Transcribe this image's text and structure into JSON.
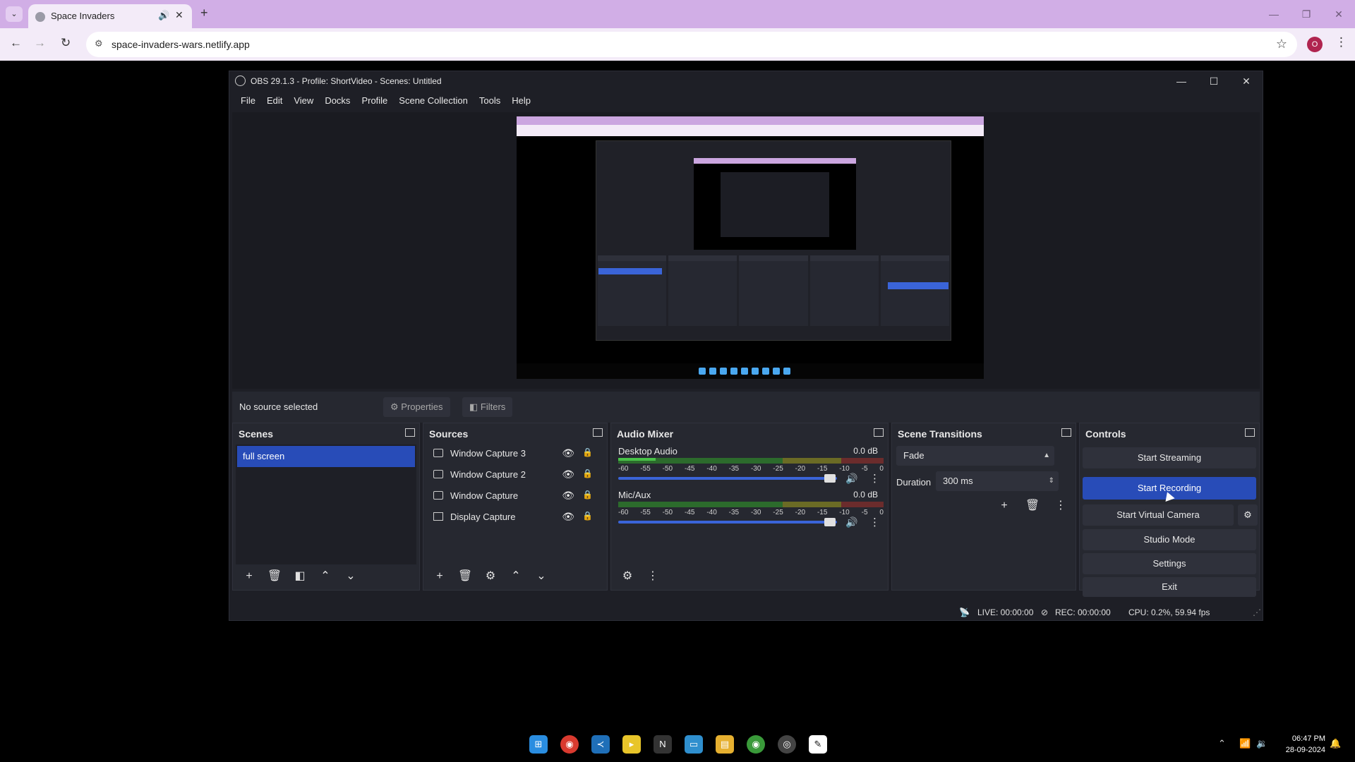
{
  "browser": {
    "tab_title": "Space Invaders",
    "url": "space-invaders-wars.netlify.app",
    "profile_initial": "O"
  },
  "obs": {
    "title": "OBS 29.1.3 - Profile: ShortVideo - Scenes: Untitled",
    "menu": [
      "File",
      "Edit",
      "View",
      "Docks",
      "Profile",
      "Scene Collection",
      "Tools",
      "Help"
    ],
    "source_bar": {
      "no_source": "No source selected",
      "properties": "Properties",
      "filters": "Filters"
    },
    "scenes": {
      "title": "Scenes",
      "items": [
        "full screen"
      ]
    },
    "sources": {
      "title": "Sources",
      "items": [
        "Window Capture 3",
        "Window Capture 2",
        "Window Capture",
        "Display Capture"
      ]
    },
    "audio_mixer": {
      "title": "Audio Mixer",
      "channels": [
        {
          "name": "Desktop Audio",
          "db": "0.0 dB",
          "level": 0.14
        },
        {
          "name": "Mic/Aux",
          "db": "0.0 dB",
          "level": 0.0
        }
      ],
      "scale": [
        "-60",
        "-55",
        "-50",
        "-45",
        "-40",
        "-35",
        "-30",
        "-25",
        "-20",
        "-15",
        "-10",
        "-5",
        "0"
      ]
    },
    "transitions": {
      "title": "Scene Transitions",
      "type": "Fade",
      "duration_label": "Duration",
      "duration_value": "300 ms"
    },
    "controls": {
      "title": "Controls",
      "start_streaming": "Start Streaming",
      "start_recording": "Start Recording",
      "start_virtual_camera": "Start Virtual Camera",
      "studio_mode": "Studio Mode",
      "settings": "Settings",
      "exit": "Exit"
    },
    "status": {
      "live": "LIVE: 00:00:00",
      "rec": "REC: 00:00:00",
      "cpu": "CPU: 0.2%, 59.94 fps"
    }
  },
  "taskbar": {
    "time": "06:47 PM",
    "date": "28-09-2024"
  },
  "colors": {
    "accent": "#284cb8",
    "tabstrip": "#d1aee6",
    "obs_bg": "#1e1f26"
  }
}
